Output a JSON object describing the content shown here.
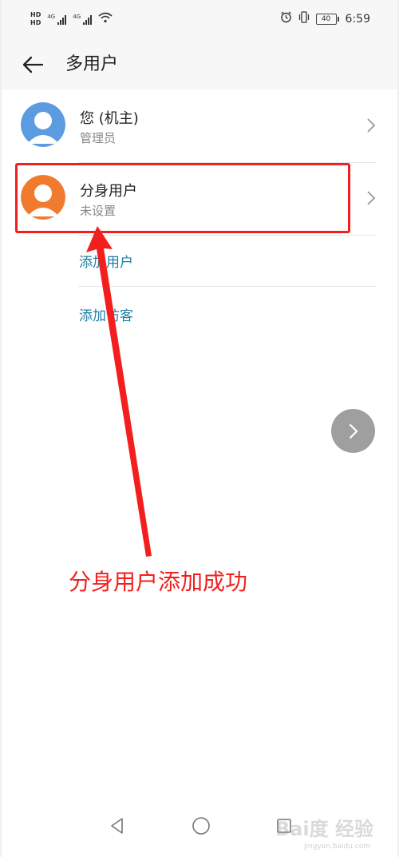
{
  "status_bar": {
    "hd_labels": [
      "HD",
      "HD"
    ],
    "signal_labels": [
      "4G",
      "4G"
    ],
    "battery_level": "40",
    "time": "6:59",
    "icons": [
      "alarm-icon",
      "vibrate-icon",
      "wifi-icon",
      "battery-icon"
    ]
  },
  "header": {
    "title": "多用户"
  },
  "users": [
    {
      "name": "您 (机主)",
      "role": "管理员",
      "avatar_color": "#5b9bdf"
    },
    {
      "name": "分身用户",
      "role": "未设置",
      "avatar_color": "#f07b2e"
    }
  ],
  "actions": {
    "add_user": "添加用户",
    "add_guest": "添加访客"
  },
  "annotation": {
    "text": "分身用户添加成功",
    "color": "#f31f1f"
  },
  "colors": {
    "link": "#1c7fa6",
    "highlight": "#f31f1f"
  },
  "watermark": {
    "brand": "Bai度 经验",
    "url": "jingyan.baidu.com"
  }
}
